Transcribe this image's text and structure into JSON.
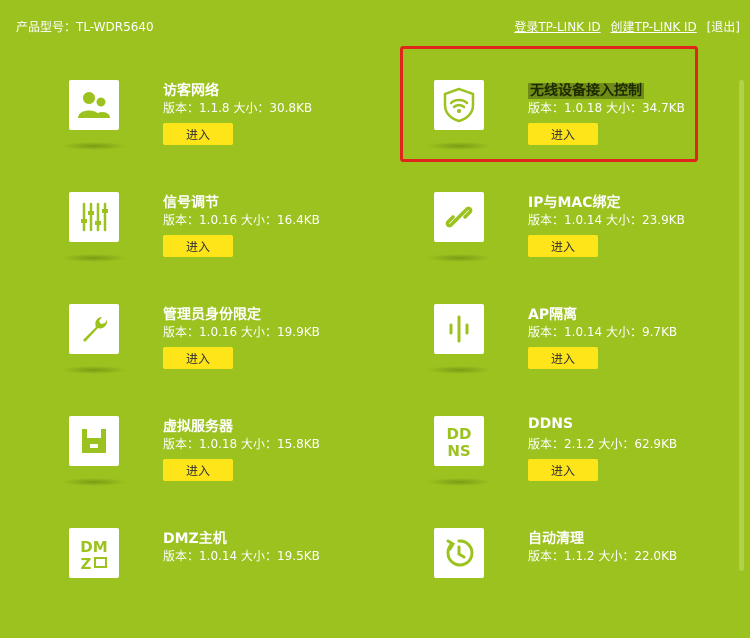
{
  "header": {
    "model_label": "产品型号：TL-WDR5640",
    "login_link": "登录TP-LINK ID",
    "create_link": "创建TP-LINK ID",
    "logout_link": "[退出]"
  },
  "apps": [
    {
      "name": "访客网络",
      "version": "版本：1.1.8 大小：30.8KB",
      "button": "进入",
      "icon": "guest-users-icon"
    },
    {
      "name": "无线设备接入控制",
      "version": "版本：1.0.18 大小：34.7KB",
      "button": "进入",
      "icon": "wifi-shield-icon",
      "highlighted": true
    },
    {
      "name": "信号调节",
      "version": "版本：1.0.16 大小：16.4KB",
      "button": "进入",
      "icon": "sliders-icon"
    },
    {
      "name": "IP与MAC绑定",
      "version": "版本：1.0.14 大小：23.9KB",
      "button": "进入",
      "icon": "link-icon"
    },
    {
      "name": "管理员身份限定",
      "version": "版本：1.0.16 大小：19.9KB",
      "button": "进入",
      "icon": "wrench-icon"
    },
    {
      "name": "AP隔离",
      "version": "版本：1.0.14 大小：9.7KB",
      "button": "进入",
      "icon": "ap-isolation-icon"
    },
    {
      "name": "虚拟服务器",
      "version": "版本：1.0.18 大小：15.8KB",
      "button": "进入",
      "icon": "server-icon"
    },
    {
      "name": "DDNS",
      "version": "版本：2.1.2 大小：62.9KB",
      "button": "进入",
      "icon": "ddns-icon",
      "icon_text": "DD NS"
    },
    {
      "name": "DMZ主机",
      "version": "版本：1.0.14 大小：19.5KB",
      "button": "进入",
      "icon": "dmz-icon",
      "icon_text": "DMZ"
    },
    {
      "name": "自动清理",
      "version": "版本：1.1.2 大小：22.0KB",
      "button": "进入",
      "icon": "auto-clean-icon"
    }
  ],
  "colors": {
    "background": "#9cc21f",
    "icon_color": "#9cc21f",
    "button": "#fde51a",
    "selection_box": "#e0261c"
  }
}
